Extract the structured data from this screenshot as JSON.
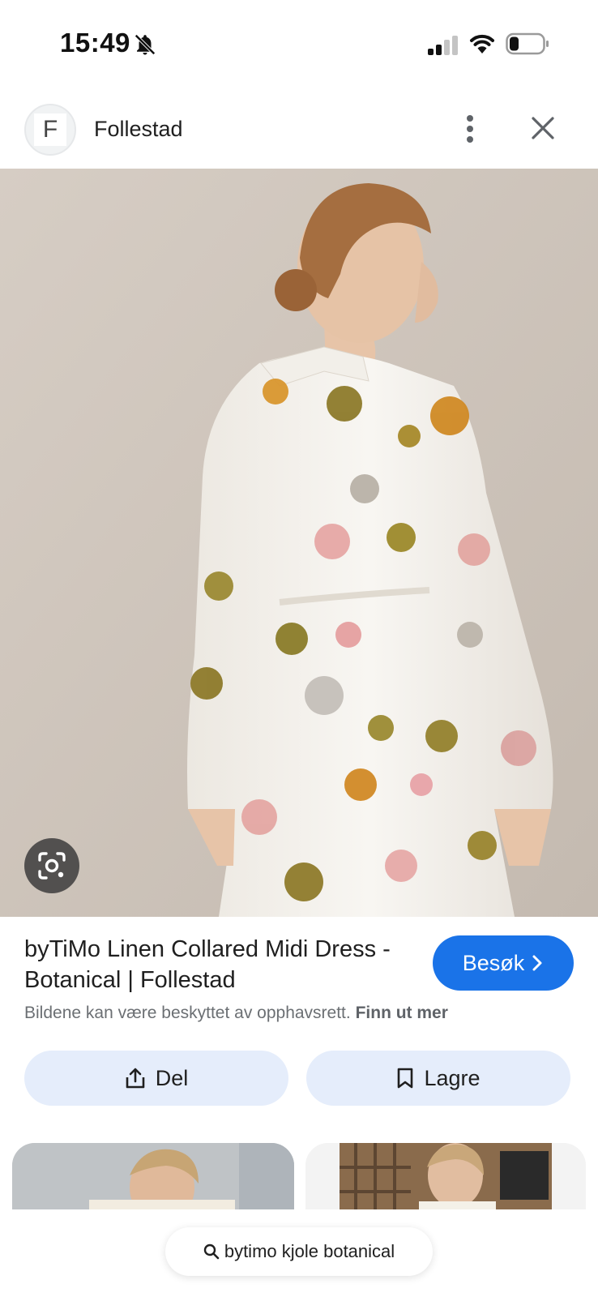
{
  "status_bar": {
    "time": "15:49",
    "icons": [
      "bell-off-icon",
      "signal-icon",
      "wifi-icon",
      "battery-icon"
    ]
  },
  "header": {
    "avatar_letter": "F",
    "site_name": "Follestad"
  },
  "result": {
    "title": "byTiMo Linen Collared Midi Dress - Botanical | Follestad",
    "visit_label": "Besøk",
    "copyright_text": "Bildene kan være beskyttet av opphavsrett.",
    "learn_more": "Finn ut mer",
    "share_label": "Del",
    "save_label": "Lagre"
  },
  "search": {
    "query": "bytimo kjole botanical"
  },
  "colors": {
    "accent": "#1a73e8",
    "action_bg": "#e5edfb"
  }
}
